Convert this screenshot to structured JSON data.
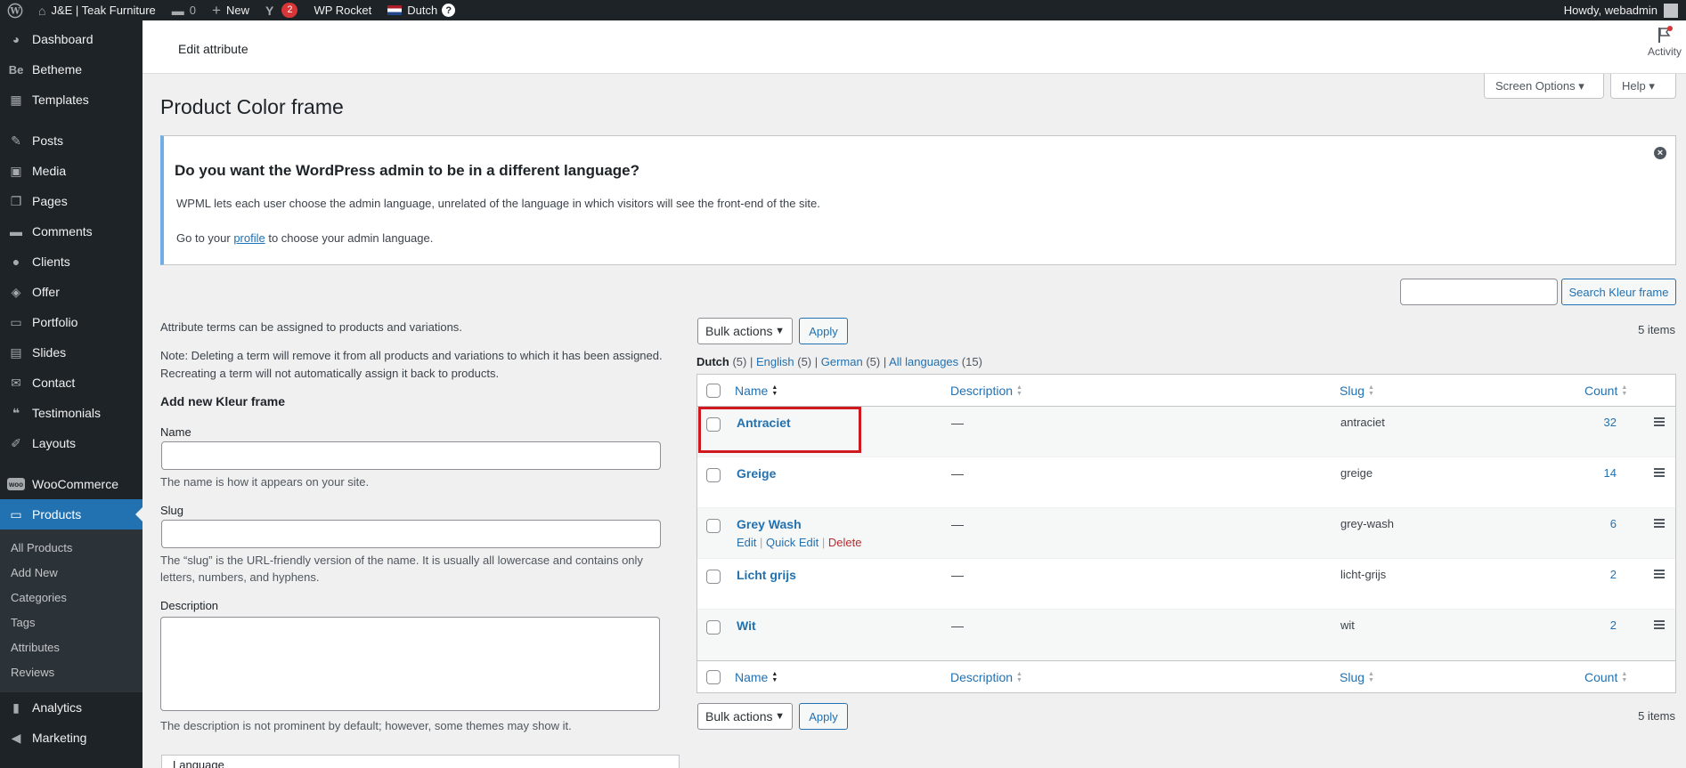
{
  "adminbar": {
    "site_name": "J&E | Teak Furniture",
    "comments_count": "0",
    "new_label": "New",
    "yoast_badge": "2",
    "rocket_label": "WP Rocket",
    "language_label": "Dutch",
    "howdy": "Howdy, webadmin"
  },
  "sidebar": {
    "items_top": [
      {
        "label": "Dashboard",
        "icon": "dashboard-icon"
      },
      {
        "label": "Betheme",
        "icon": "betheme-icon"
      },
      {
        "label": "Templates",
        "icon": "templates-icon"
      }
    ],
    "items_mid": [
      {
        "label": "Posts",
        "icon": "pin-icon"
      },
      {
        "label": "Media",
        "icon": "media-icon"
      },
      {
        "label": "Pages",
        "icon": "pages-icon"
      },
      {
        "label": "Comments",
        "icon": "comments-icon"
      },
      {
        "label": "Clients",
        "icon": "clients-icon"
      },
      {
        "label": "Offer",
        "icon": "offer-icon"
      },
      {
        "label": "Portfolio",
        "icon": "portfolio-icon"
      },
      {
        "label": "Slides",
        "icon": "slides-icon"
      },
      {
        "label": "Contact",
        "icon": "contact-icon"
      },
      {
        "label": "Testimonials",
        "icon": "quote-icon"
      },
      {
        "label": "Layouts",
        "icon": "layouts-icon"
      }
    ],
    "woocommerce": "WooCommerce",
    "products": "Products",
    "submenu": [
      "All Products",
      "Add New",
      "Categories",
      "Tags",
      "Attributes",
      "Reviews"
    ],
    "analytics": "Analytics",
    "marketing": "Marketing"
  },
  "header": {
    "title": "Edit attribute",
    "activity": "Activity"
  },
  "screen_options": "Screen Options ▾",
  "help": "Help ▾",
  "page_title": "Product Color frame",
  "notice": {
    "heading": "Do you want the WordPress admin to be in a different language?",
    "p1": "WPML lets each user choose the admin language, unrelated of the language in which visitors will see the front-end of the site.",
    "p2_before": "Go to your ",
    "p2_link": "profile",
    "p2_after": " to choose your admin language."
  },
  "form": {
    "intro": "Attribute terms can be assigned to products and variations.",
    "note": "Note: Deleting a term will remove it from all products and variations to which it has been assigned. Recreating a term will not automatically assign it back to products.",
    "heading": "Add new Kleur frame",
    "name_label": "Name",
    "name_desc": "The name is how it appears on your site.",
    "slug_label": "Slug",
    "slug_desc": "The “slug” is the URL-friendly version of the name. It is usually all lowercase and contains only letters, numbers, and hyphens.",
    "desc_label": "Description",
    "desc_desc": "The description is not prominent by default; however, some themes may show it.",
    "language_label": "Language"
  },
  "search_button": "Search Kleur frame",
  "bulk_actions": "Bulk actions",
  "apply": "Apply",
  "items_count": "5 items",
  "lang_filter": {
    "dutch": "Dutch",
    "dutch_count": "(5)",
    "english": "English",
    "english_count": "(5)",
    "german": "German",
    "german_count": "(5)",
    "all": "All languages",
    "all_count": "(15)",
    "sep": " | "
  },
  "columns": {
    "name": "Name",
    "description": "Description",
    "slug": "Slug",
    "count": "Count"
  },
  "rows": [
    {
      "name": "Antraciet",
      "description": "—",
      "slug": "antraciet",
      "count": "32"
    },
    {
      "name": "Greige",
      "description": "—",
      "slug": "greige",
      "count": "14"
    },
    {
      "name": "Grey Wash",
      "description": "—",
      "slug": "grey-wash",
      "count": "6"
    },
    {
      "name": "Licht grijs",
      "description": "—",
      "slug": "licht-grijs",
      "count": "2"
    },
    {
      "name": "Wit",
      "description": "—",
      "slug": "wit",
      "count": "2"
    }
  ],
  "row_actions": {
    "edit": "Edit",
    "quick_edit": "Quick Edit",
    "delete": "Delete",
    "sep": " | "
  },
  "colors": {
    "accent": "#2271b1",
    "sidebar_bg": "#1d2327",
    "highlight": "#d0191f"
  }
}
